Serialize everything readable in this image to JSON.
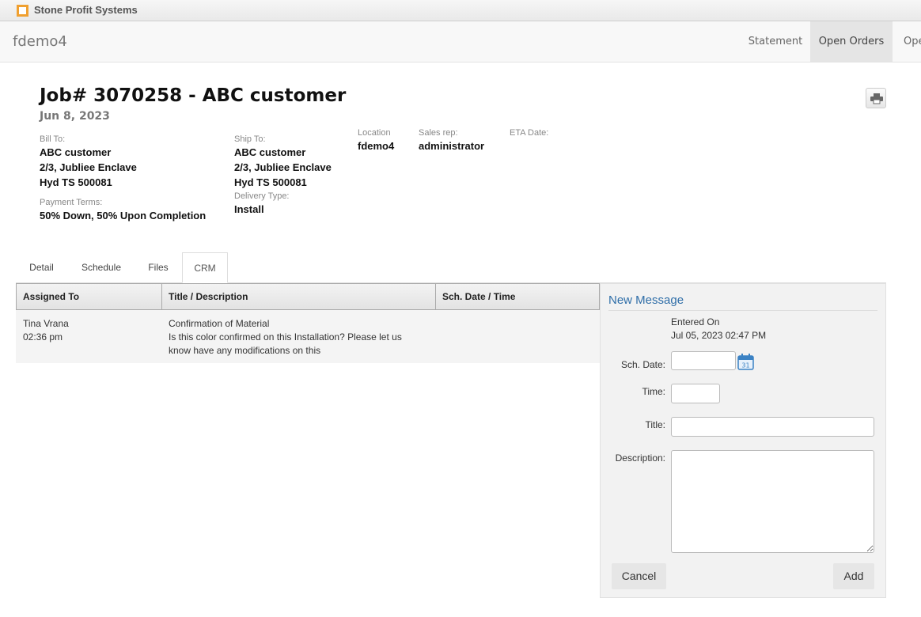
{
  "app": {
    "brand_name": "Stone Profit Systems",
    "site_name": "fdemo4",
    "nav": [
      "Statement",
      "Open Orders",
      "Ope"
    ]
  },
  "job": {
    "title": "Job# 3070258 - ABC customer",
    "date": "Jun 8, 2023",
    "print_icon": "printer-icon",
    "bill_to": {
      "label": "Bill To:",
      "lines": [
        "ABC customer",
        "2/3, Jubliee Enclave",
        "Hyd TS 500081"
      ]
    },
    "ship_to": {
      "label": "Ship To:",
      "lines": [
        "ABC customer",
        "2/3, Jubliee Enclave",
        "Hyd TS 500081"
      ]
    },
    "location": {
      "label": "Location",
      "value": "fdemo4"
    },
    "sales_rep": {
      "label": "Sales rep:",
      "value": "administrator"
    },
    "eta_date": {
      "label": "ETA Date:",
      "value": ""
    },
    "payment_terms": {
      "label": "Payment Terms:",
      "value": "50% Down, 50% Upon Completion"
    },
    "delivery_type": {
      "label": "Delivery Type:",
      "value": "Install"
    }
  },
  "tabs": [
    {
      "label": "Detail",
      "active": false
    },
    {
      "label": "Schedule",
      "active": false
    },
    {
      "label": "Files",
      "active": false
    },
    {
      "label": "CRM",
      "active": true
    }
  ],
  "crm_table": {
    "headers": [
      "Assigned To",
      "Title / Description",
      "Sch. Date / Time"
    ],
    "rows": [
      {
        "assigned_to": "Tina Vrana",
        "time": "02:36 pm",
        "title": "Confirmation of Material",
        "description_line1": "Is this color confirmed on this Installation? Please let us",
        "description_line2": "know have any modifications on this",
        "sch_date_time": ""
      }
    ]
  },
  "new_message": {
    "title": "New Message",
    "entered_on_label": "Entered On",
    "entered_on_value": "Jul 05, 2023 02:47 PM",
    "sch_date_label": "Sch. Date:",
    "sch_date_value": "",
    "calendar_icon": "calendar-icon",
    "calendar_day": "31",
    "time_label": "Time:",
    "time_value": "",
    "title_label": "Title:",
    "title_value": "",
    "description_label": "Description:",
    "description_value": "",
    "cancel_label": "Cancel",
    "add_label": "Add"
  },
  "colors": {
    "brand_accent": "#f0a030",
    "panel_title": "#2f6ea8",
    "calendar": "#3b82c4"
  }
}
